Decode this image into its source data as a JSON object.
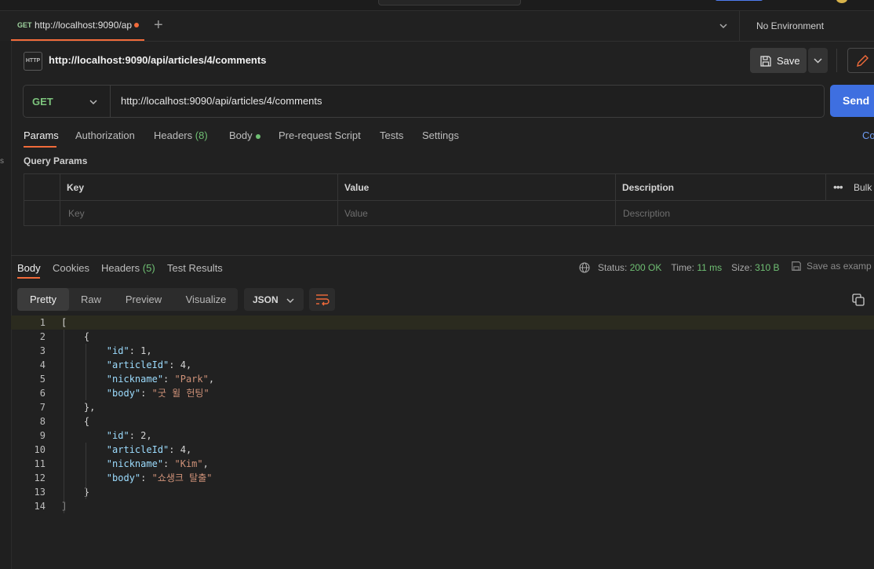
{
  "tabs": [
    {
      "method": "GET",
      "title": "http://localhost:9090/ap"
    }
  ],
  "environment": "No Environment",
  "request": {
    "icon_label": "HTTP",
    "title": "http://localhost:9090/api/articles/4/comments",
    "save_label": "Save",
    "method": "GET",
    "url": "http://localhost:9090/api/articles/4/comments",
    "send_label": "Send"
  },
  "request_tabs": {
    "params": "Params",
    "authorization": "Authorization",
    "headers": "Headers",
    "headers_count": "(8)",
    "body": "Body",
    "pre_request": "Pre-request Script",
    "tests": "Tests",
    "settings": "Settings",
    "cookies": "Co"
  },
  "left_edge_text": "s",
  "query_params": {
    "label": "Query Params",
    "headers": {
      "key": "Key",
      "value": "Value",
      "description": "Description",
      "bulk": "Bulk"
    },
    "placeholders": {
      "key": "Key",
      "value": "Value",
      "description": "Description"
    }
  },
  "response": {
    "tabs": {
      "body": "Body",
      "cookies": "Cookies",
      "headers": "Headers",
      "headers_count": "(5)",
      "test_results": "Test Results"
    },
    "status_label": "Status:",
    "status_value": "200 OK",
    "time_label": "Time:",
    "time_value": "11 ms",
    "size_label": "Size:",
    "size_value": "310 B",
    "save_example": "Save as examp",
    "views": [
      "Pretty",
      "Raw",
      "Preview",
      "Visualize"
    ],
    "format": "JSON",
    "code": [
      {
        "n": "1",
        "indent": 0,
        "parts": [
          [
            "p",
            "["
          ]
        ]
      },
      {
        "n": "2",
        "indent": 1,
        "parts": [
          [
            "p",
            "{"
          ]
        ]
      },
      {
        "n": "3",
        "indent": 2,
        "parts": [
          [
            "k",
            "\"id\""
          ],
          [
            "p",
            ": "
          ],
          [
            "n",
            "1"
          ],
          [
            "p",
            ","
          ]
        ]
      },
      {
        "n": "4",
        "indent": 2,
        "parts": [
          [
            "k",
            "\"articleId\""
          ],
          [
            "p",
            ": "
          ],
          [
            "n",
            "4"
          ],
          [
            "p",
            ","
          ]
        ]
      },
      {
        "n": "5",
        "indent": 2,
        "parts": [
          [
            "k",
            "\"nickname\""
          ],
          [
            "p",
            ": "
          ],
          [
            "s",
            "\"Park\""
          ],
          [
            "p",
            ","
          ]
        ]
      },
      {
        "n": "6",
        "indent": 2,
        "parts": [
          [
            "k",
            "\"body\""
          ],
          [
            "p",
            ": "
          ],
          [
            "s",
            "\"굿 윌 헌팅\""
          ]
        ]
      },
      {
        "n": "7",
        "indent": 1,
        "parts": [
          [
            "p",
            "},"
          ]
        ]
      },
      {
        "n": "8",
        "indent": 1,
        "parts": [
          [
            "p",
            "{"
          ]
        ]
      },
      {
        "n": "9",
        "indent": 2,
        "parts": [
          [
            "k",
            "\"id\""
          ],
          [
            "p",
            ": "
          ],
          [
            "n",
            "2"
          ],
          [
            "p",
            ","
          ]
        ]
      },
      {
        "n": "10",
        "indent": 2,
        "parts": [
          [
            "k",
            "\"articleId\""
          ],
          [
            "p",
            ": "
          ],
          [
            "n",
            "4"
          ],
          [
            "p",
            ","
          ]
        ]
      },
      {
        "n": "11",
        "indent": 2,
        "parts": [
          [
            "k",
            "\"nickname\""
          ],
          [
            "p",
            ": "
          ],
          [
            "s",
            "\"Kim\""
          ],
          [
            "p",
            ","
          ]
        ]
      },
      {
        "n": "12",
        "indent": 2,
        "parts": [
          [
            "k",
            "\"body\""
          ],
          [
            "p",
            ": "
          ],
          [
            "s",
            "\"쇼생크 탈출\""
          ]
        ]
      },
      {
        "n": "13",
        "indent": 1,
        "parts": [
          [
            "p",
            "}"
          ]
        ]
      },
      {
        "n": "14",
        "indent": 0,
        "parts": [
          [
            "p",
            "]"
          ]
        ]
      }
    ]
  },
  "colors": {
    "accent": "#f26b3a",
    "send": "#3e6fe0",
    "success": "#6fbf73",
    "json_key": "#9cdcfe",
    "json_string": "#ce9178"
  }
}
